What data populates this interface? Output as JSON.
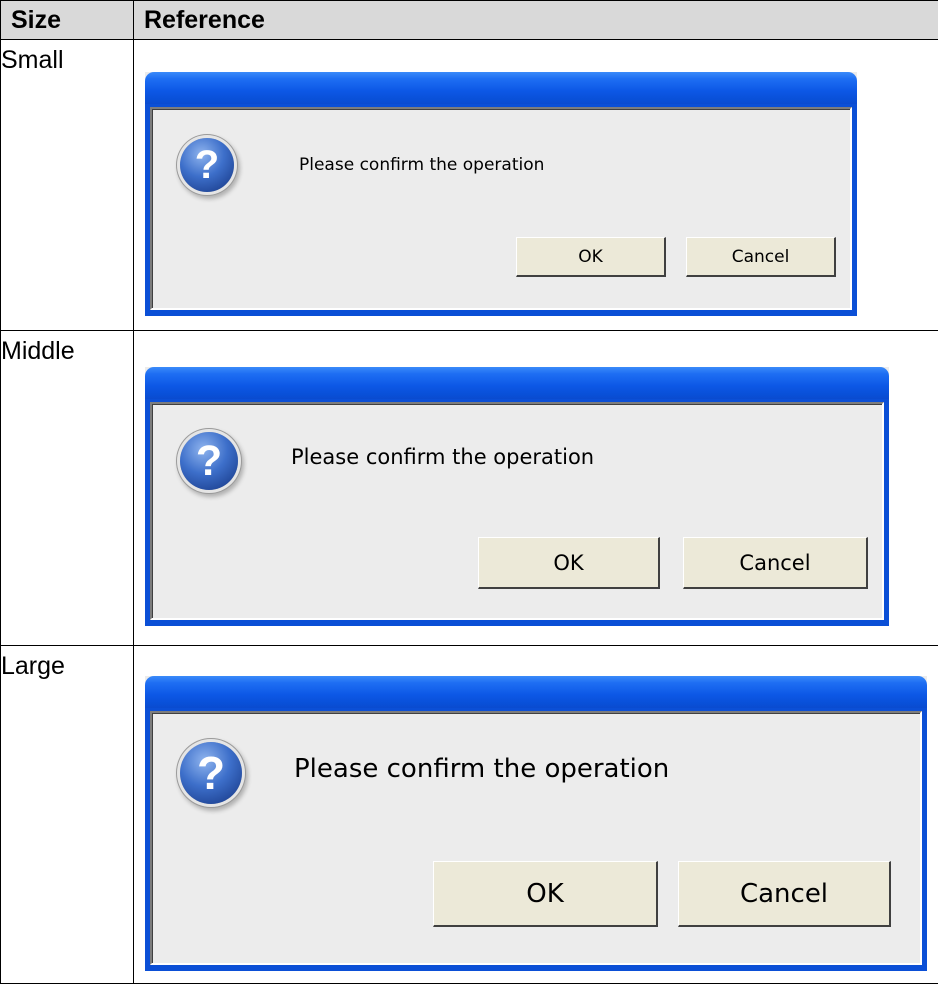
{
  "table": {
    "headers": {
      "size": "Size",
      "reference": "Reference"
    },
    "rows": [
      {
        "size": "Small",
        "dialog": {
          "message": "Please confirm the operation",
          "ok_label": "OK",
          "cancel_label": "Cancel",
          "icon": "question-icon",
          "icon_glyph": "?"
        }
      },
      {
        "size": "Middle",
        "dialog": {
          "message": "Please confirm the operation",
          "ok_label": "OK",
          "cancel_label": "Cancel",
          "icon": "question-icon",
          "icon_glyph": "?"
        }
      },
      {
        "size": "Large",
        "dialog": {
          "message": "Please confirm the operation",
          "ok_label": "OK",
          "cancel_label": "Cancel",
          "icon": "question-icon",
          "icon_glyph": "?"
        }
      }
    ]
  },
  "colors": {
    "titlebar": "#0950d8",
    "dialog_body": "#ececec",
    "button": "#ece9d8",
    "header_bg": "#d9d9d9"
  }
}
